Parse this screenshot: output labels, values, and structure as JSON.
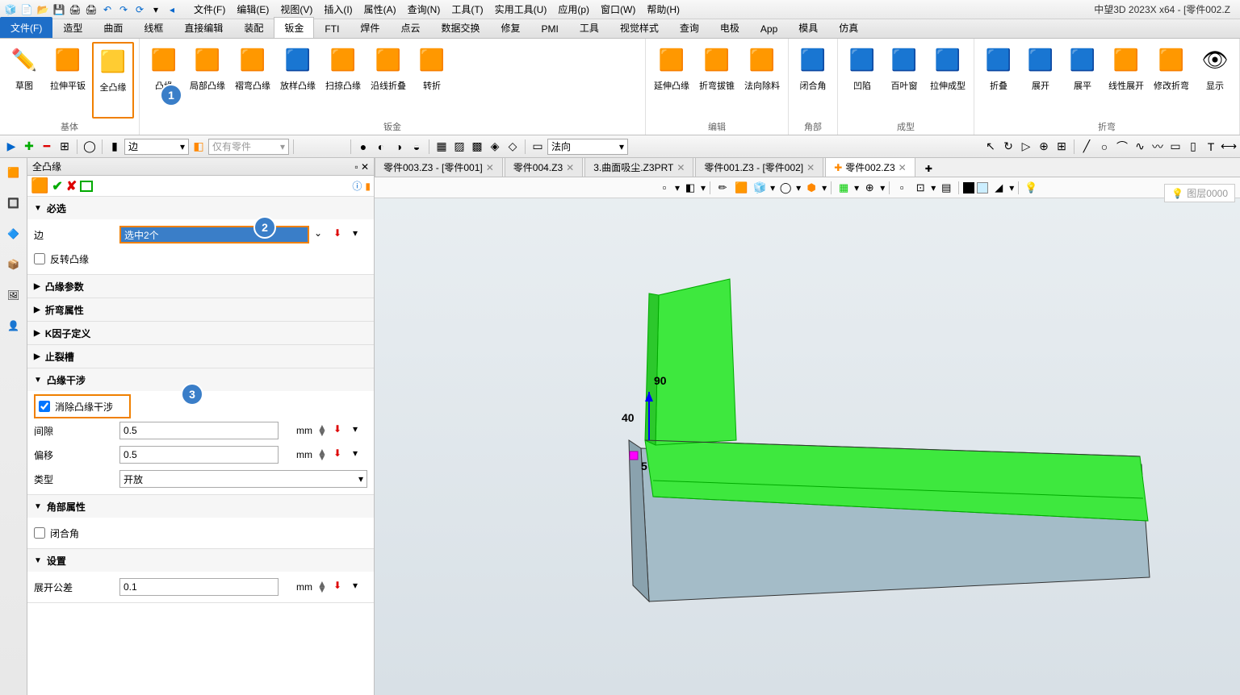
{
  "app_title": "中望3D 2023X x64 - [零件002.Z",
  "menus": [
    "文件(F)",
    "编辑(E)",
    "视图(V)",
    "插入(I)",
    "属性(A)",
    "查询(N)",
    "工具(T)",
    "实用工具(U)",
    "应用(p)",
    "窗口(W)",
    "帮助(H)"
  ],
  "ribbon_tabs": [
    "文件(F)",
    "造型",
    "曲面",
    "线框",
    "直接编辑",
    "装配",
    "钣金",
    "FTI",
    "焊件",
    "点云",
    "数据交换",
    "修复",
    "PMI",
    "工具",
    "视觉样式",
    "查询",
    "电极",
    "App",
    "模具",
    "仿真"
  ],
  "active_ribbon_tab": "钣金",
  "ribbon_groups": {
    "g1": {
      "label": "基体",
      "items": [
        "草图",
        "拉伸平钣",
        "全凸缘"
      ]
    },
    "g2": {
      "label": "钣金",
      "items": [
        "凸缘",
        "局部凸缘",
        "褶弯凸缘",
        "放样凸缘",
        "扫掠凸缘",
        "沿线折叠",
        "转折"
      ]
    },
    "g3": {
      "label": "编辑",
      "items": [
        "延伸凸缘",
        "折弯拔锥",
        "法向除料"
      ]
    },
    "g4": {
      "label": "角部",
      "items": [
        "闭合角"
      ]
    },
    "g5": {
      "label": "成型",
      "items": [
        "凹陷",
        "百叶窗",
        "拉伸成型"
      ]
    },
    "g6": {
      "label": "折弯",
      "items": [
        "折叠",
        "展开",
        "展平",
        "线性展开",
        "修改折弯",
        "显示"
      ]
    }
  },
  "toolbar_combo1": "边",
  "toolbar_combo2": "仅有零件",
  "toolbar_combo3": "法向",
  "panel_title": "全凸缘",
  "sections": {
    "required": {
      "title": "必选",
      "edge_label": "边",
      "edge_value": "选中2个",
      "reverse": "反转凸缘"
    },
    "flange_params": "凸缘参数",
    "bend_attr": "折弯属性",
    "kfactor": "K因子定义",
    "relief": "止裂槽",
    "interference": {
      "title": "凸缘干涉",
      "remove": "消除凸缘干涉",
      "gap_label": "间隙",
      "gap": "0.5",
      "offset_label": "偏移",
      "offset": "0.5",
      "type_label": "类型",
      "type": "开放"
    },
    "corner": {
      "title": "角部属性",
      "closed": "闭合角"
    },
    "settings": {
      "title": "设置",
      "tol_label": "展开公差",
      "tol": "0.1"
    }
  },
  "unit": "mm",
  "doc_tabs": [
    {
      "label": "零件003.Z3 - [零件001]",
      "active": false,
      "close": true
    },
    {
      "label": "零件004.Z3",
      "active": false,
      "close": true
    },
    {
      "label": "3.曲面吸尘.Z3PRT",
      "active": false,
      "close": true
    },
    {
      "label": "零件001.Z3 - [零件002]",
      "active": false,
      "close": true
    },
    {
      "label": "零件002.Z3",
      "active": true,
      "close": true,
      "plus": true
    }
  ],
  "dimensions": {
    "d1": "90",
    "d2": "40",
    "d3": "5"
  },
  "layer": "图层0000",
  "badges": {
    "b1": "1",
    "b2": "2",
    "b3": "3"
  }
}
